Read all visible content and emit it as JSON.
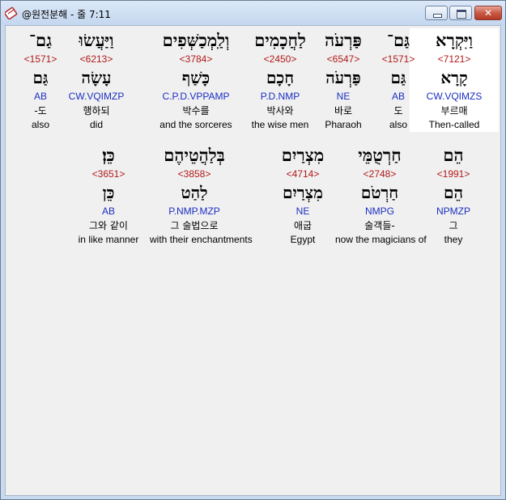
{
  "window": {
    "title": "@원전분해 - 줄 7:11",
    "close_label": "✕"
  },
  "lines": [
    {
      "words": [
        {
          "hebrew": "וַיִּקְרָא",
          "strong": "<7121>",
          "lemma": "קָרָא",
          "morph": "CW.VQIMZS",
          "korean": "부르매",
          "english": "Then-called",
          "selected": true
        },
        {
          "hebrew": "גַּם־",
          "strong": "<1571>",
          "lemma": "גַּם",
          "morph": "AB",
          "korean": "도",
          "english": "also",
          "selected": false
        },
        {
          "hebrew": "פַּרְעֹה",
          "strong": "<6547>",
          "lemma": "פַּרְעֹה",
          "morph": "NE",
          "korean": "바로",
          "english": "Pharaoh",
          "selected": false
        },
        {
          "hebrew": "לַחֲכָמִים",
          "strong": "<2450>",
          "lemma": "חָכָם",
          "morph": "P.D.NMP",
          "korean": "박사와",
          "english": "the wise men",
          "selected": false
        },
        {
          "hebrew": "וְלַֽמְכַשְּׁפִים",
          "strong": "<3784>",
          "lemma": "כָּשַׁף",
          "morph": "C.P.D.VPPAMP",
          "korean": "박수를",
          "english": "and the sorceres",
          "selected": false
        },
        {
          "hebrew": "וַיַּעֲשׂוּ",
          "strong": "<6213>",
          "lemma": "עָשָׂה",
          "morph": "CW.VQIMZP",
          "korean": "행하되",
          "english": "did",
          "selected": false
        },
        {
          "hebrew": "גַם־",
          "strong": "<1571>",
          "lemma": "גַּם",
          "morph": "AB",
          "korean": "-도",
          "english": "also",
          "selected": false
        }
      ]
    },
    {
      "words": [
        {
          "hebrew": "הֵם",
          "strong": "<1991>",
          "lemma": "הֵם",
          "morph": "NPMZP",
          "korean": "그",
          "english": "they",
          "selected": false
        },
        {
          "hebrew": "חַרְטֻמֵּי",
          "strong": "<2748>",
          "lemma": "חַרְטֹם",
          "morph": "NMPG",
          "korean": "술객들-",
          "english": "now the magicians of",
          "selected": false
        },
        {
          "hebrew": "מִצְרַיִם",
          "strong": "<4714>",
          "lemma": "מִצְרַיִם",
          "morph": "NE",
          "korean": "애굽",
          "english": "Egypt",
          "selected": false
        },
        {
          "hebrew": "בְּלַהֲטֵיהֶם",
          "strong": "<3858>",
          "lemma": "לַהַט",
          "morph": "P.NMP.MZP",
          "korean": "그 술법으로",
          "english": "with their enchantments",
          "selected": false
        },
        {
          "hebrew": "כֵּן׃",
          "strong": "<3651>",
          "lemma": "כֵּן",
          "morph": "AB",
          "korean": "그와 같이",
          "english": "in like manner",
          "selected": false
        }
      ]
    }
  ]
}
